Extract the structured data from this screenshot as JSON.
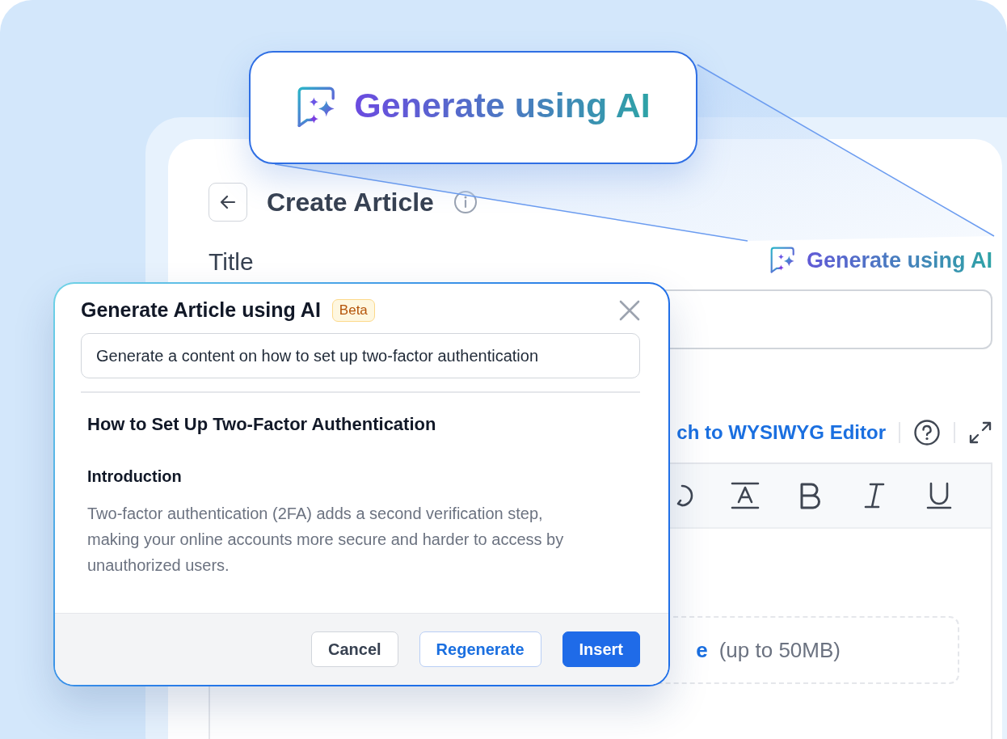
{
  "callout": {
    "label": "Generate using AI"
  },
  "page": {
    "title": "Create Article",
    "field_label": "Title",
    "ai_link": "Generate using AI",
    "editor_switch": "ch to WYSIWYG Editor",
    "upload_link": "e",
    "upload_note": "(up to 50MB)"
  },
  "modal": {
    "title": "Generate Article using AI",
    "badge": "Beta",
    "prompt": "Generate a content on how to set up two-factor authentication",
    "heading": "How to Set Up Two-Factor Authentication",
    "subheading": "Introduction",
    "body": "Two-factor authentication (2FA) adds a second verification step, making your online accounts more secure and harder to access by unauthorized users.",
    "buttons": [
      {
        "label": "Cancel",
        "kind": "secondary"
      },
      {
        "label": "Regenerate",
        "kind": "outline"
      },
      {
        "label": "Insert",
        "kind": "primary"
      }
    ]
  }
}
